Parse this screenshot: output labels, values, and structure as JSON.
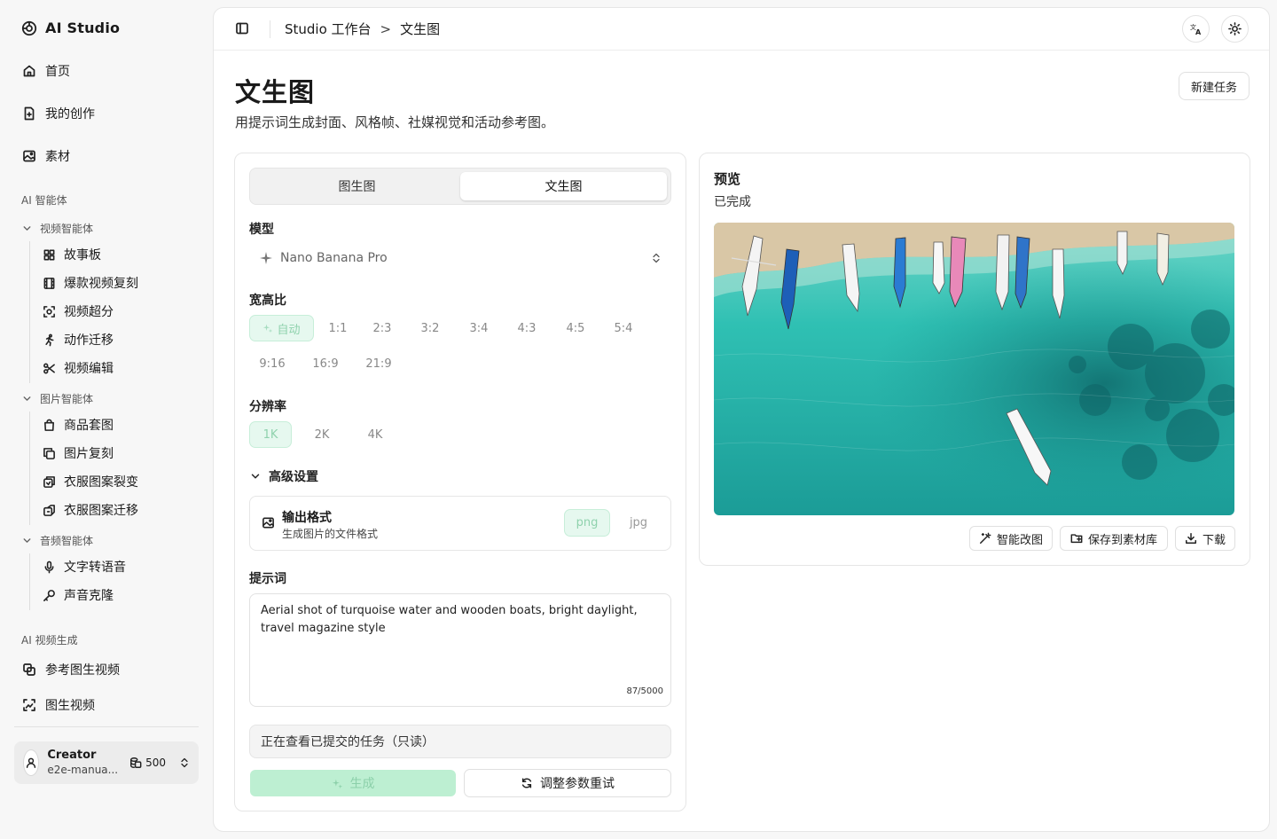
{
  "app": {
    "name": "AI Studio"
  },
  "sidebar": {
    "main": [
      {
        "label": "首页",
        "icon": "home-icon"
      },
      {
        "label": "我的创作",
        "icon": "file-icon"
      },
      {
        "label": "素材",
        "icon": "image-icon"
      }
    ],
    "section_agents": "AI 智能体",
    "video_group": {
      "label": "视频智能体",
      "items": [
        {
          "label": "故事板",
          "icon": "grid-icon"
        },
        {
          "label": "爆款视频复刻",
          "icon": "film-icon"
        },
        {
          "label": "视频超分",
          "icon": "scan-icon"
        },
        {
          "label": "动作迁移",
          "icon": "running-icon"
        },
        {
          "label": "视频编辑",
          "icon": "scissors-icon"
        }
      ]
    },
    "image_group": {
      "label": "图片智能体",
      "items": [
        {
          "label": "商品套图",
          "icon": "bag-icon"
        },
        {
          "label": "图片复刻",
          "icon": "copy-icon"
        },
        {
          "label": "衣服图案裂变",
          "icon": "pattern-icon"
        },
        {
          "label": "衣服图案迁移",
          "icon": "transfer-icon"
        }
      ]
    },
    "audio_group": {
      "label": "音频智能体",
      "items": [
        {
          "label": "文字转语音",
          "icon": "mic-icon"
        },
        {
          "label": "声音克隆",
          "icon": "clone-icon"
        }
      ]
    },
    "section_video_gen": "AI 视频生成",
    "video_gen": [
      {
        "label": "参考图生视频",
        "icon": "ref-video-icon"
      },
      {
        "label": "图生视频",
        "icon": "image-video-icon"
      }
    ],
    "user": {
      "name": "Creator",
      "sub": "e2e-manua...",
      "credits": "500"
    }
  },
  "topbar": {
    "breadcrumb": [
      "Studio 工作台",
      "文生图"
    ],
    "separator": ">"
  },
  "page": {
    "title": "文生图",
    "description": "用提示词生成封面、风格帧、社媒视觉和活动参考图。",
    "new_task": "新建任务"
  },
  "form": {
    "tabs": [
      {
        "label": "图生图"
      },
      {
        "label": "文生图"
      }
    ],
    "active_tab": 1,
    "model_label": "模型",
    "model_value": "Nano Banana Pro",
    "ratio_label": "宽高比",
    "ratios": [
      "自动",
      "1:1",
      "2:3",
      "3:2",
      "3:4",
      "4:3",
      "4:5",
      "5:4",
      "9:16",
      "16:9",
      "21:9"
    ],
    "ratio_selected": "自动",
    "resolution_label": "分辨率",
    "resolutions": [
      "1K",
      "2K",
      "4K"
    ],
    "resolution_selected": "1K",
    "advanced_label": "高级设置",
    "format_title": "输出格式",
    "format_sub": "生成图片的文件格式",
    "formats": [
      "png",
      "jpg"
    ],
    "format_selected": "png",
    "prompt_label": "提示词",
    "prompt_value": "Aerial shot of turquoise water and wooden boats, bright daylight, travel magazine style",
    "prompt_counter": "87/5000",
    "readonly_notice": "正在查看已提交的任务（只读）",
    "generate_label": "生成",
    "retry_label": "调整参数重试"
  },
  "preview": {
    "title": "预览",
    "status": "已完成",
    "actions": {
      "edit": "智能改图",
      "save": "保存到素材库",
      "download": "下载"
    }
  },
  "colors": {
    "accent": "#bdefd2",
    "accent_text": "#8cd0aa",
    "water": "#2bb8ae",
    "sand": "#d8c7a8"
  }
}
